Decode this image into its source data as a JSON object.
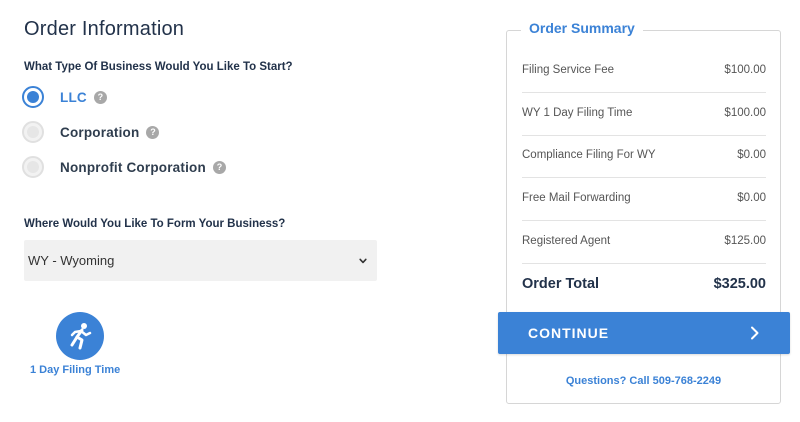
{
  "page_title": "Order Information",
  "business_question": "What Type Of Business Would You Like To Start?",
  "business_types": [
    {
      "label": "LLC",
      "selected": true
    },
    {
      "label": "Corporation",
      "selected": false
    },
    {
      "label": "Nonprofit Corporation",
      "selected": false
    }
  ],
  "help_glyph": "?",
  "state_question": "Where Would You Like To Form Your Business?",
  "state_select": {
    "value": "WY - Wyoming"
  },
  "feature": {
    "label": "1 Day Filing Time",
    "icon": "running-person-icon"
  },
  "summary": {
    "title": "Order Summary",
    "items": [
      {
        "label": "Filing Service Fee",
        "value": "$100.00"
      },
      {
        "label": "WY 1 Day Filing Time",
        "value": "$100.00"
      },
      {
        "label": "Compliance Filing For WY",
        "value": "$0.00"
      },
      {
        "label": "Free Mail Forwarding",
        "value": "$0.00"
      },
      {
        "label": "Registered Agent",
        "value": "$125.00"
      }
    ],
    "total_label": "Order Total",
    "total_value": "$325.00",
    "continue_label": "CONTINUE",
    "questions_text": "Questions? Call 509-768-2249"
  },
  "colors": {
    "accent": "#3b82d6",
    "heading": "#22324a"
  }
}
